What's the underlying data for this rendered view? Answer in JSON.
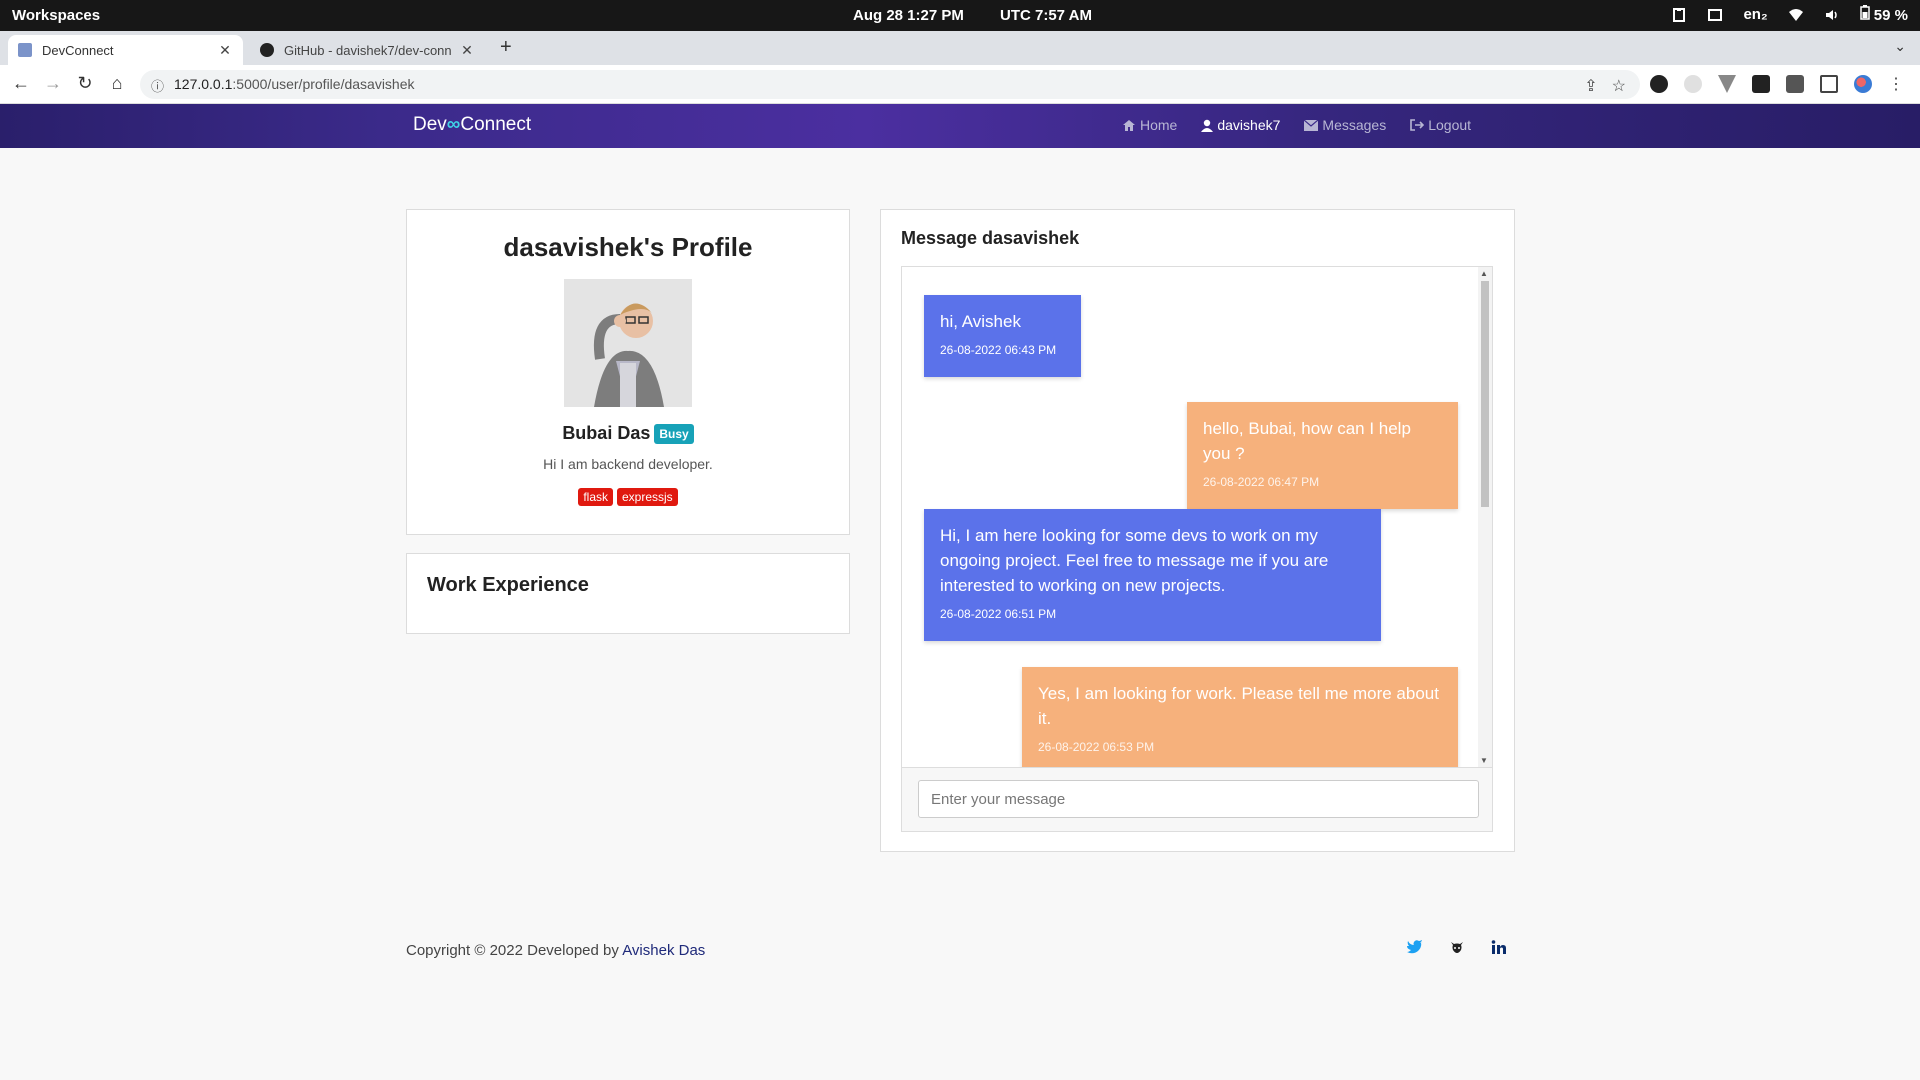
{
  "os_bar": {
    "workspaces": "Workspaces",
    "date_time": "Aug 28   1:27 PM",
    "utc": "UTC  7:57 AM",
    "lang": "en₂",
    "battery": "59 %"
  },
  "browser": {
    "tabs": [
      {
        "title": "DevConnect"
      },
      {
        "title": "GitHub - davishek7/dev-conn"
      }
    ],
    "url_host": "127.0.0.1",
    "url_path": ":5000/user/profile/dasavishek"
  },
  "site": {
    "brand_left": "Dev",
    "brand_icon": "∞",
    "brand_right": "Connect",
    "nav": {
      "home": "Home",
      "user": "davishek7",
      "messages": "Messages",
      "logout": "Logout"
    }
  },
  "profile": {
    "title": "dasavishek's Profile",
    "name": "Bubai Das",
    "status": "Busy",
    "bio": "Hi I am backend developer.",
    "skills": [
      "flask",
      "expressjs"
    ]
  },
  "work": {
    "title": "Work Experience"
  },
  "messages": {
    "title": "Message dasavishek",
    "items": [
      {
        "text": "hi, Avishek",
        "time": "26-08-2022 06:43 PM",
        "direction": "incoming"
      },
      {
        "text": "hello, Bubai, how can I help you ?",
        "time": "26-08-2022 06:47 PM",
        "direction": "outgoing"
      },
      {
        "text": "Hi, I am here looking for some devs to work on my ongoing project. Feel free to message me if you are interested to working on new projects.",
        "time": "26-08-2022 06:51 PM",
        "direction": "incoming"
      },
      {
        "text": "Yes, I am looking for work. Please tell me more about it.",
        "time": "26-08-2022 06:53 PM",
        "direction": "outgoing"
      }
    ],
    "input_placeholder": "Enter your message"
  },
  "footer": {
    "copyright": "Copyright © 2022 Developed by",
    "author": "Avishek Das",
    "social": [
      "twitter-icon",
      "github-icon",
      "linkedin-icon"
    ]
  },
  "colors": {
    "incoming_bubble": "#5b72ea",
    "outgoing_bubble": "#f6b17c",
    "busy_badge": "#17a2b8",
    "skill_tag": "#e0190f"
  }
}
